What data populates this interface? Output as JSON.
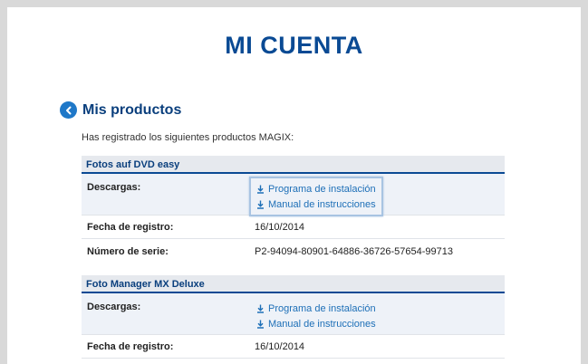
{
  "page": {
    "title": "MI CUENTA"
  },
  "section": {
    "title": "Mis productos",
    "intro": "Has registrado los siguientes productos MAGIX:"
  },
  "products": [
    {
      "name": "Fotos auf DVD easy",
      "downloads_label": "Descargas:",
      "links": [
        "Programa de instalación",
        "Manual de instrucciones"
      ],
      "date_label": "Fecha de registro:",
      "date": "16/10/2014",
      "serial_label": "Número de serie:",
      "serial": "P2-94094-80901-64886-36726-57654-99713"
    },
    {
      "name": "Foto Manager MX Deluxe",
      "downloads_label": "Descargas:",
      "links": [
        "Programa de instalación",
        "Manual de instrucciones"
      ],
      "date_label": "Fecha de registro:",
      "date": "16/10/2014"
    }
  ],
  "colors": {
    "title": "#0a4a94",
    "link": "#1d6fb7",
    "back_button": "#1f78c8"
  },
  "icons": {
    "back": "chevron-left-icon",
    "download": "download-icon"
  }
}
